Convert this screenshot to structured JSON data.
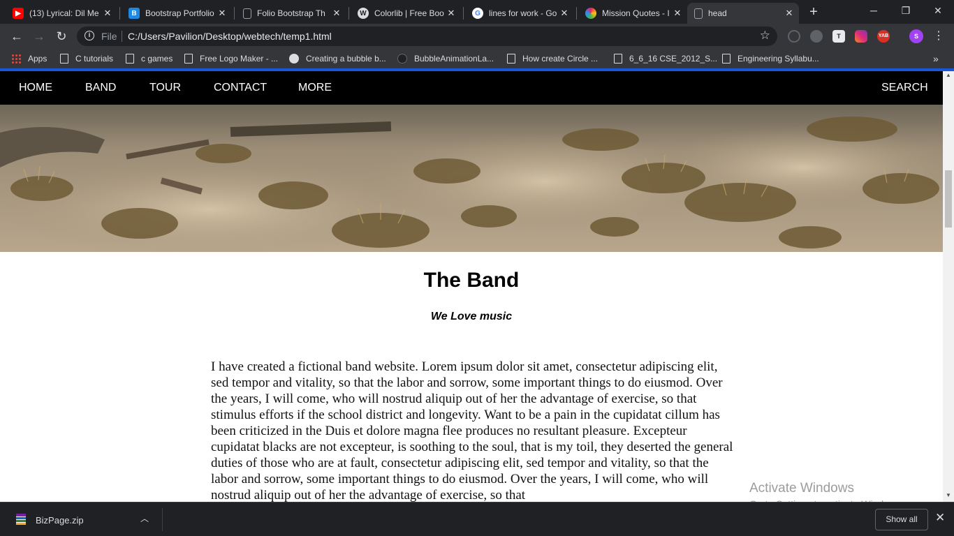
{
  "browser": {
    "tabs": [
      {
        "title": "(13) Lyrical: Dil Me",
        "favicon": "youtube-icon",
        "color": "#ff0000"
      },
      {
        "title": "Bootstrap Portfolio",
        "favicon": "bootstrap-icon",
        "color": "#1e88e5"
      },
      {
        "title": "Folio Bootstrap Th",
        "favicon": "page-icon",
        "color": "#9aa0a6"
      },
      {
        "title": "Colorlib | Free Boo",
        "favicon": "wordpress-icon",
        "color": "#dadce0"
      },
      {
        "title": "lines for work - Go",
        "favicon": "google-icon",
        "color": "#4285f4"
      },
      {
        "title": "Mission Quotes - I",
        "favicon": "pinwheel-icon",
        "color": "#e91e63"
      },
      {
        "title": "head",
        "favicon": "page-icon",
        "color": "#9aa0a6"
      }
    ],
    "omnibox": {
      "scheme_label": "File",
      "url": "C:/Users/Pavilion/Desktop/webtech/temp1.html"
    },
    "extensions": [
      {
        "name": "sync-icon",
        "label": "",
        "color": "#5f6368"
      },
      {
        "name": "gamepad-icon",
        "label": "",
        "color": "#5f6368"
      },
      {
        "name": "text-extension-icon",
        "label": "T",
        "color": "#e8eaed"
      },
      {
        "name": "instagram-icon",
        "label": "",
        "color": "#e1306c"
      },
      {
        "name": "yab-icon",
        "label": "YAB",
        "color": "#d93025"
      },
      {
        "name": "profile-avatar",
        "label": "S",
        "color": "#a142f4"
      }
    ],
    "bookmarks": [
      {
        "label": "Apps",
        "icon": "apps-grid-icon"
      },
      {
        "label": "C tutorials",
        "icon": "page-icon"
      },
      {
        "label": "c games",
        "icon": "page-icon"
      },
      {
        "label": "Free Logo Maker - ...",
        "icon": "page-icon"
      },
      {
        "label": "Creating a bubble b...",
        "icon": "bubble-icon"
      },
      {
        "label": "BubbleAnimationLa...",
        "icon": "github-icon"
      },
      {
        "label": "How create Circle ...",
        "icon": "page-icon"
      },
      {
        "label": "6_6_16 CSE_2012_S...",
        "icon": "page-icon"
      },
      {
        "label": "Engineering Syllabu...",
        "icon": "page-icon"
      }
    ],
    "accent_color": "#1a56db"
  },
  "site": {
    "nav": {
      "items": [
        "HOME",
        "BAND",
        "TOUR",
        "CONTACT",
        "MORE"
      ],
      "search": "SEARCH"
    },
    "band": {
      "title": "The Band",
      "subtitle": "We Love music",
      "body": "I have created a fictional band website. Lorem ipsum dolor sit amet, consectetur adipiscing elit, sed tempor and vitality, so that the labor and sorrow, some important things to do eiusmod. Over the years, I will come, who will nostrud aliquip out of her the advantage of exercise, so that stimulus efforts if the school district and longevity. Want to be a pain in the cupidatat cillum has been criticized in the Duis et dolore magna flee produces no resultant pleasure. Excepteur cupidatat blacks are not excepteur, is soothing to the soul, that is my toil, they deserted the general duties of those who are at fault, consectetur adipiscing elit, sed tempor and vitality, so that the labor and sorrow, some important things to do eiusmod. Over the years, I will come, who will nostrud aliquip out of her the advantage of exercise, so that"
    }
  },
  "os": {
    "watermark_title": "Activate Windows",
    "watermark_sub": "Go to Settings to activate Windows."
  },
  "downloads": {
    "file": "BizPage.zip",
    "show_all": "Show all"
  }
}
